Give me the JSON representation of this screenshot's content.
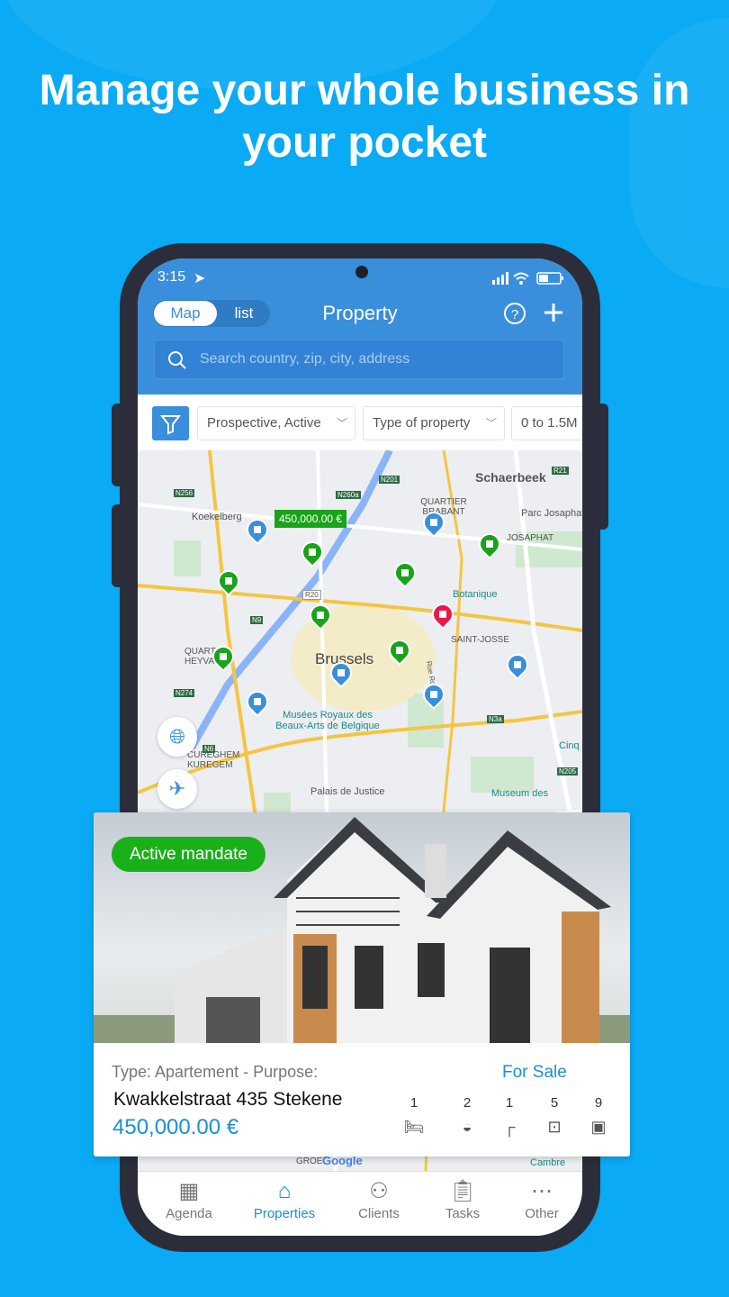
{
  "headline": "Manage your whole business in your pocket",
  "status": {
    "time": "3:15"
  },
  "header": {
    "toggle_map": "Map",
    "toggle_list": "list",
    "title": "Property",
    "search_placeholder": "Search country, zip, city, address"
  },
  "filters": {
    "status": "Prospective, Active",
    "type": "Type of property",
    "price": "0 to 1.5M"
  },
  "map": {
    "price_tag": "450,000.00 €",
    "labels": [
      "Schaerbeek",
      "Koekelberg",
      "QUARTIER BRABANT",
      "Parc Josaphat",
      "JOSAPHAT",
      "Botanique",
      "Brussels",
      "SAINT-JOSSE",
      "QUARTIER HEYVAERT",
      "Musées Royaux des Beaux-Arts de Belgique",
      "CUREGHEM KUREGEM",
      "Palais de Justice",
      "Museum des",
      "Cinq",
      "Rue Royale",
      "GROE",
      "Cambre"
    ],
    "roads": [
      "N256",
      "N201",
      "N260a",
      "R21",
      "R20",
      "N9",
      "N274",
      "N6",
      "N3a",
      "N205"
    ],
    "google": "Google",
    "pin_colors": {
      "active": "#1aa31a",
      "prospective": "#3a8fdc",
      "selected": "#e8184a"
    }
  },
  "card": {
    "badge": "Active mandate",
    "type_purpose": "Type: Apartement - Purpose:",
    "purpose": "For Sale",
    "address": "Kwakkelstraat 435 Stekene",
    "price": "450,000.00 €",
    "features": [
      {
        "icon": "bed-icon",
        "count": "1"
      },
      {
        "icon": "bathtub-icon",
        "count": "2"
      },
      {
        "icon": "shower-icon",
        "count": "1"
      },
      {
        "icon": "rooms-icon",
        "count": "5"
      },
      {
        "icon": "area-icon",
        "count": "9"
      }
    ]
  },
  "tabs": [
    {
      "label": "Agenda",
      "icon": "calendar-icon"
    },
    {
      "label": "Properties",
      "icon": "home-icon",
      "active": true
    },
    {
      "label": "Clients",
      "icon": "users-icon"
    },
    {
      "label": "Tasks",
      "icon": "clipboard-icon"
    },
    {
      "label": "Other",
      "icon": "more-icon"
    }
  ],
  "colors": {
    "background": "#0aaaf5",
    "header": "#3a8fdc",
    "accent": "#1a8fd8",
    "badge": "#1ab01a"
  }
}
